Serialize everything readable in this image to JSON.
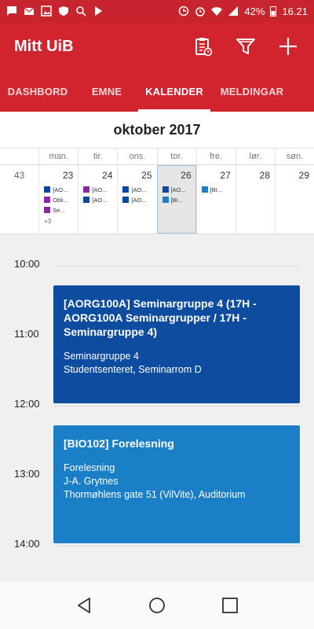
{
  "status_bar": {
    "time": "16.21",
    "battery": "42%",
    "icons": [
      "message-icon",
      "mail-icon",
      "image-icon",
      "vpn-icon",
      "search-icon",
      "play-icon",
      "alarm-sync-icon",
      "alarm-icon",
      "wifi-icon",
      "signal-icon",
      "battery-icon"
    ]
  },
  "app": {
    "title": "Mitt UiB",
    "actions": [
      "clipboard-icon",
      "filter-icon",
      "add-icon"
    ]
  },
  "tabs": [
    {
      "label": "DASHBORD",
      "active": false
    },
    {
      "label": "EMNE",
      "active": false
    },
    {
      "label": "KALENDER",
      "active": true
    },
    {
      "label": "MELDINGAR",
      "active": false
    }
  ],
  "calendar": {
    "month": "oktober 2017",
    "weekdays": [
      "",
      "man.",
      "tir.",
      "ons.",
      "tor.",
      "fre.",
      "lør.",
      "søn."
    ],
    "week_number": "43",
    "days": [
      {
        "num": "23",
        "today": false,
        "events": [
          {
            "color": "#0d47a1",
            "label": "[AO..."
          },
          {
            "color": "#8e24aa",
            "label": "Obli..."
          },
          {
            "color": "#8e24aa",
            "label": "Se..."
          }
        ],
        "more": "+3"
      },
      {
        "num": "24",
        "today": false,
        "events": [
          {
            "color": "#8e24aa",
            "label": "[AO..."
          },
          {
            "color": "#0d47a1",
            "label": "[AO..."
          }
        ],
        "more": ""
      },
      {
        "num": "25",
        "today": false,
        "events": [
          {
            "color": "#0d47a1",
            "label": "[AO..."
          },
          {
            "color": "#0d47a1",
            "label": "[AO..."
          }
        ],
        "more": ""
      },
      {
        "num": "26",
        "today": true,
        "events": [
          {
            "color": "#0d47a1",
            "label": "[AO..."
          },
          {
            "color": "#1a7fc7",
            "label": "[BI..."
          }
        ],
        "more": ""
      },
      {
        "num": "27",
        "today": false,
        "events": [
          {
            "color": "#1a7fc7",
            "label": "[BI..."
          }
        ],
        "more": ""
      },
      {
        "num": "28",
        "today": false,
        "events": [],
        "more": ""
      },
      {
        "num": "29",
        "today": false,
        "events": [],
        "more": ""
      }
    ]
  },
  "dayview": {
    "hours": [
      "10:00",
      "11:00",
      "12:00",
      "13:00",
      "14:00"
    ],
    "events": [
      {
        "title": "[AORG100A] Seminargruppe 4 (17H - AORG100A Seminargrupper / 17H - Seminargruppe 4)",
        "lines": [
          "Seminargruppe 4",
          "Studentsenteret, Seminarrom D"
        ],
        "color": "#0d4c9f",
        "start": "10:15",
        "end": "12:00"
      },
      {
        "title": "[BIO102] Forelesning",
        "lines": [
          "Forelesning",
          "J-A. Grytnes",
          "Thormøhlens gate 51 (VilVite), Auditorium"
        ],
        "color": "#1a7fc7",
        "start": "12:15",
        "end": "14:00"
      }
    ]
  },
  "nav_bar": {
    "buttons": [
      "back-icon",
      "home-icon",
      "recents-icon"
    ]
  }
}
